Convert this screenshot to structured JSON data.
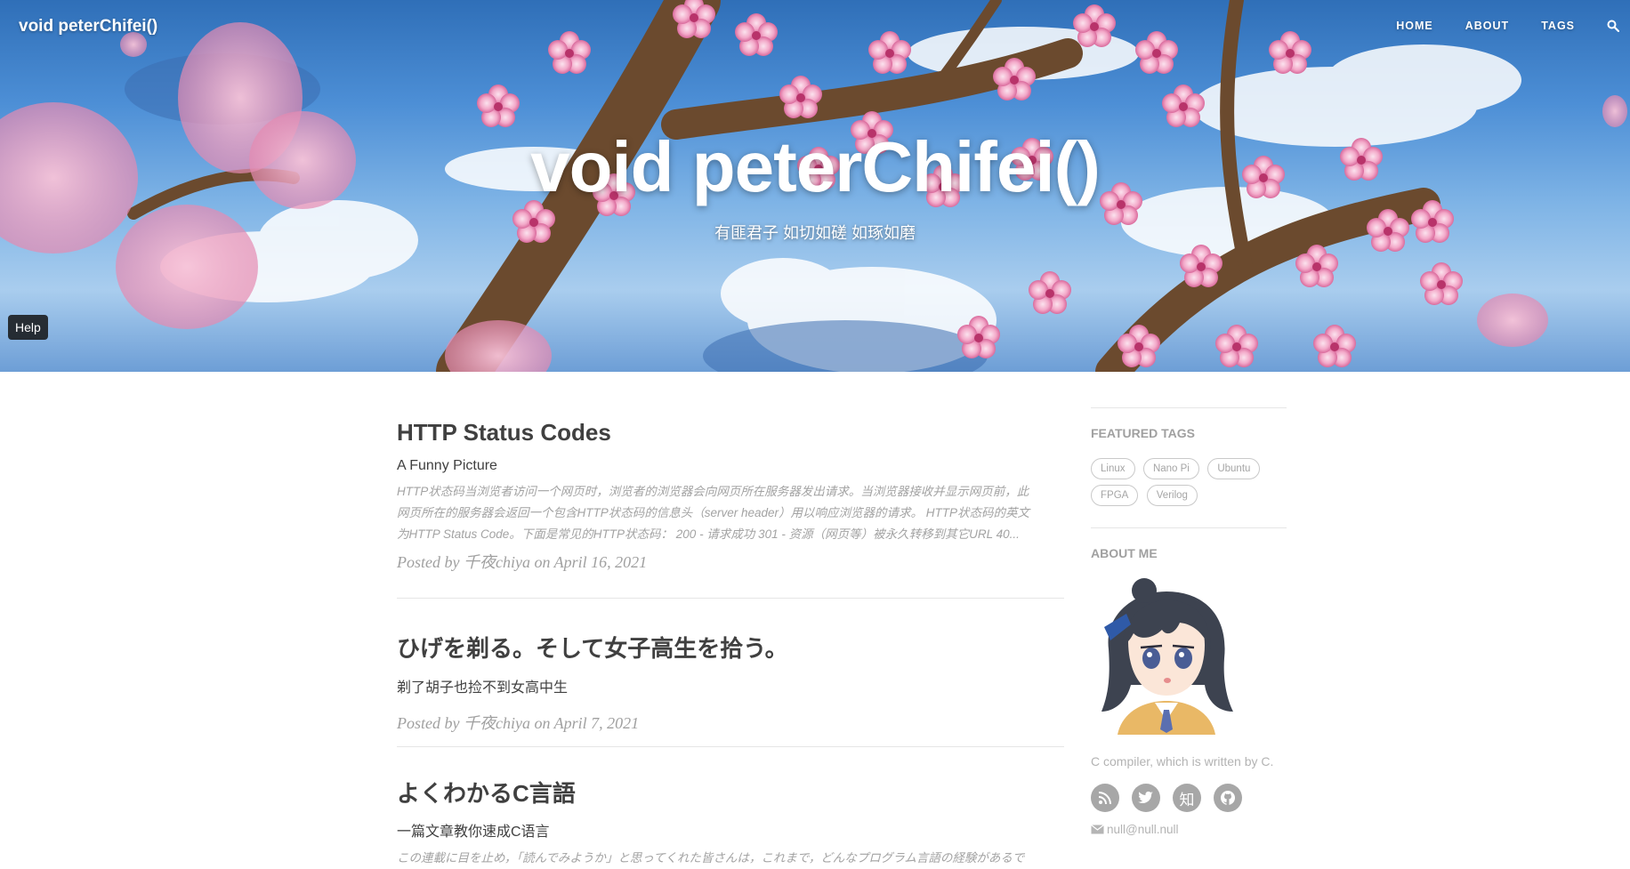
{
  "navbar": {
    "brand": "void peterChifei()",
    "links": [
      "HOME",
      "ABOUT",
      "TAGS"
    ],
    "search_icon": "search-icon"
  },
  "hero": {
    "title": "void peterChifei()",
    "subtitle": "有匪君子 如切如磋 如琢如磨",
    "help_label": "Help"
  },
  "posts": [
    {
      "title": "HTTP Status Codes",
      "subtitle": "A Funny Picture",
      "excerpt_lines": [
        "HTTP状态码当浏览者访问一个网页时，浏览者的浏览器会向网页所在服务器发出请求。当浏览器接收并显示网页前，此",
        "网页所在的服务器会返回一个包含HTTP状态码的信息头（server header）用以响应浏览器的请求。 HTTP状态码的英文",
        "为HTTP Status Code。下面是常见的HTTP状态码： 200 - 请求成功 301 - 资源（网页等）被永久转移到其它URL 40..."
      ],
      "meta": "Posted by 千夜chiya on April 16, 2021"
    },
    {
      "title": "ひげを剃る。そして女子高生を拾う。",
      "subtitle": "剃了胡子也捡不到女高中生",
      "meta": "Posted by 千夜chiya on April 7, 2021"
    },
    {
      "title": "よくわかるC言語",
      "subtitle": "一篇文章教你速成C语言",
      "excerpt_lines": [
        "この連載に目を止め，「読んでみようか」と思ってくれた皆さんは，これまで，どんなプログラム言語の経験があるで"
      ]
    }
  ],
  "sidebar": {
    "featured_tags_heading": "FEATURED TAGS",
    "tags": [
      "Linux",
      "Nano Pi",
      "Ubuntu",
      "FPGA",
      "Verilog"
    ],
    "about_heading": "ABOUT ME",
    "bio": "C compiler, which is written by C.",
    "social": [
      {
        "name": "rss-icon",
        "glyph": ""
      },
      {
        "name": "twitter-icon",
        "glyph": ""
      },
      {
        "name": "zhihu-icon",
        "glyph": "知"
      },
      {
        "name": "github-icon",
        "glyph": ""
      }
    ],
    "email": "null@null.null"
  },
  "colors": {
    "text": "#404040",
    "muted": "#a0a0a0",
    "tag_border": "#c9c9c9",
    "social_bg": "#a7a7a7"
  }
}
